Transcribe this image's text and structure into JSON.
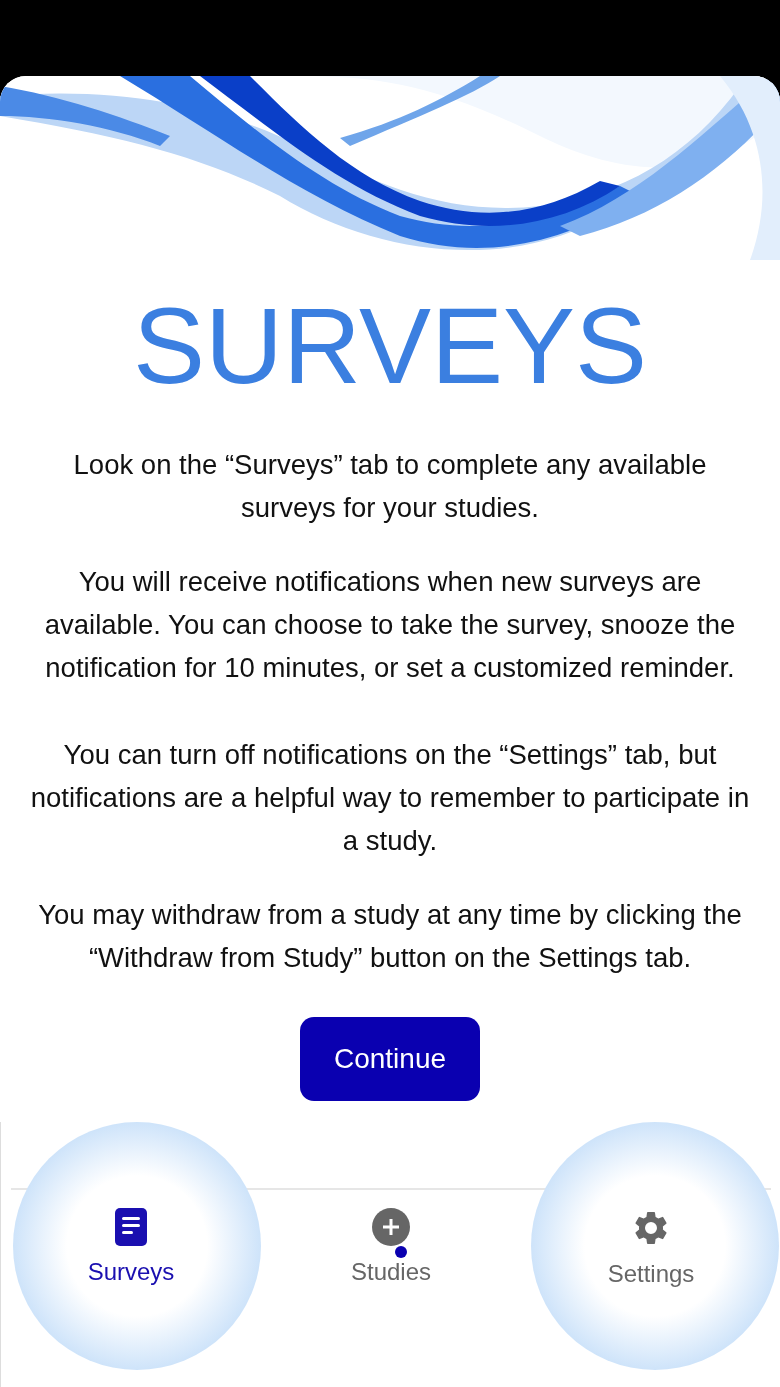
{
  "title": "SURVEYS",
  "paragraphs": [
    "Look on the “Surveys” tab to complete any available surveys for your studies.",
    "You will receive notifications when new surveys are available. You can choose to take the survey, snooze the notification for 10 minutes, or set a customized reminder.",
    "You can turn off notifications on the “Settings” tab, but notifications are a helpful way to remember to participate in a study.",
    "You may withdraw from a study at any time by clicking the “Withdraw from Study” button on the Settings tab."
  ],
  "continue_button": "Continue",
  "tabs": [
    {
      "label": "Surveys",
      "selected": true,
      "badge": false
    },
    {
      "label": "Studies",
      "selected": false,
      "badge": true
    },
    {
      "label": "Settings",
      "selected": false,
      "badge": false
    }
  ]
}
